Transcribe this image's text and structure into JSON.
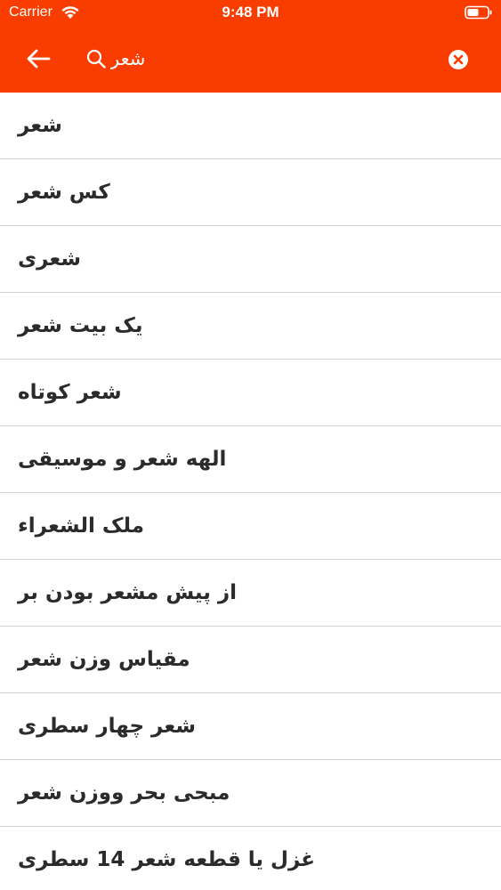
{
  "status_bar": {
    "carrier": "Carrier",
    "time": "9:48 PM",
    "wifi_icon": "wifi-icon",
    "battery_icon": "battery-icon"
  },
  "header": {
    "background_color": "#f93c00",
    "back_icon": "arrow-left-icon",
    "search_icon": "magnifier-icon",
    "search_value": "شعر",
    "clear_icon": "clear-circle-icon"
  },
  "results": [
    "شعر",
    "کس شعر",
    "شعری",
    "یک بیت شعر",
    "شعر کوتاه",
    "الهه شعر و موسیقی",
    "ملک الشعراء",
    "از پیش مشعر بودن بر",
    "مقیاس وزن شعر",
    "شعر چهار سطری",
    "مبحی بحر ووزن شعر",
    "غزل یا قطعه شعر 14 سطری"
  ]
}
